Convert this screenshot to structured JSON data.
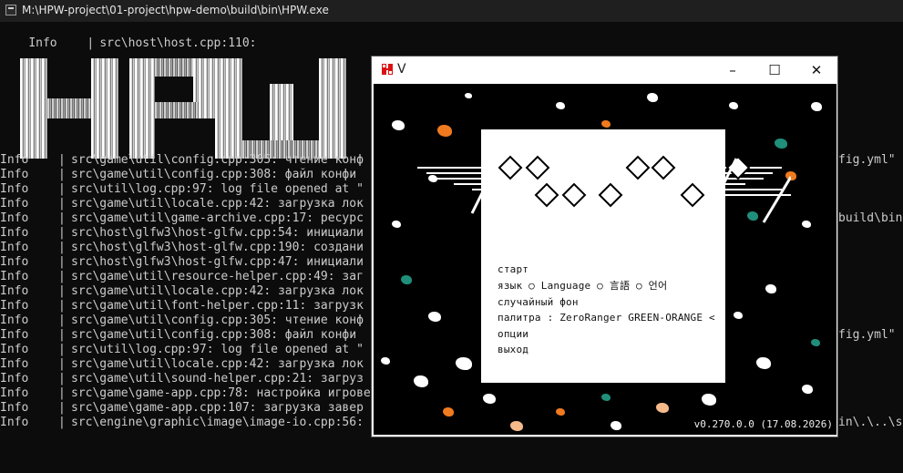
{
  "console": {
    "title": "M:\\HPW-project\\01-project\\hpw-demo\\build\\bin\\HPW.exe",
    "banner_text": "HPW",
    "first_line": {
      "level": "Info",
      "text": "src\\host\\host.cpp:110:"
    },
    "lines": [
      {
        "level": "Info",
        "text": "src\\game\\util\\config.cpp:305: чтение конф"
      },
      {
        "level": "Info",
        "text": "src\\game\\util\\config.cpp:308: файл конфи"
      },
      {
        "level": "Info",
        "text": "src\\util\\log.cpp:97: log file opened at \""
      },
      {
        "level": "Info",
        "text": "src\\game\\util\\locale.cpp:42: загрузка лок"
      },
      {
        "level": "Info",
        "text": "src\\game\\util\\game-archive.cpp:17: ресурс"
      },
      {
        "level": "Info",
        "text": "src\\host\\glfw3\\host-glfw.cpp:54: инициали"
      },
      {
        "level": "Info",
        "text": "src\\host\\glfw3\\host-glfw.cpp:190: создани"
      },
      {
        "level": "Info",
        "text": "src\\host\\glfw3\\host-glfw.cpp:47: инициали"
      },
      {
        "level": "Info",
        "text": "src\\game\\util\\resource-helper.cpp:49: заг"
      },
      {
        "level": "Info",
        "text": "src\\game\\util\\locale.cpp:42: загрузка лок"
      },
      {
        "level": "Info",
        "text": "src\\game\\util\\font-helper.cpp:11: загрузк"
      },
      {
        "level": "Info",
        "text": "src\\game\\util\\config.cpp:305: чтение конф"
      },
      {
        "level": "Info",
        "text": "src\\game\\util\\config.cpp:308: файл конфи"
      },
      {
        "level": "Info",
        "text": "src\\util\\log.cpp:97: log file opened at \""
      },
      {
        "level": "Info",
        "text": "src\\game\\util\\locale.cpp:42: загрузка лок"
      },
      {
        "level": "Info",
        "text": "src\\game\\util\\sound-helper.cpp:21: загруз"
      },
      {
        "level": "Info",
        "text": "src\\game\\game-app.cpp:78: настройка игрове"
      },
      {
        "level": "Info",
        "text": "src\\game\\game-app.cpp:107: загрузка завер"
      },
      {
        "level": "Info",
        "text": "src\\engine\\graphic\\image\\image-io.cpp:56:"
      }
    ],
    "tails": [
      {
        "row": 1,
        "text": "fig.yml\""
      },
      {
        "row": 5,
        "text": "build\\bin"
      },
      {
        "row": 13,
        "text": "fig.yml\""
      },
      {
        "row": 19,
        "text": "in\\.\\..\\s"
      }
    ]
  },
  "game": {
    "title": "V",
    "menu": {
      "items": [
        "старт",
        "язык ○ Language ○ 言語 ○ 언어",
        "случайный фон",
        "палитра : ZeroRanger GREEN-ORANGE <",
        "опции",
        "выход"
      ]
    },
    "version": "v0.270.0.0 (17.08.2026)",
    "colors": {
      "orange": "#f07a1f",
      "teal": "#1f8f7a",
      "peach": "#f5b98a",
      "background": "#000000",
      "panel": "#ffffff"
    }
  }
}
